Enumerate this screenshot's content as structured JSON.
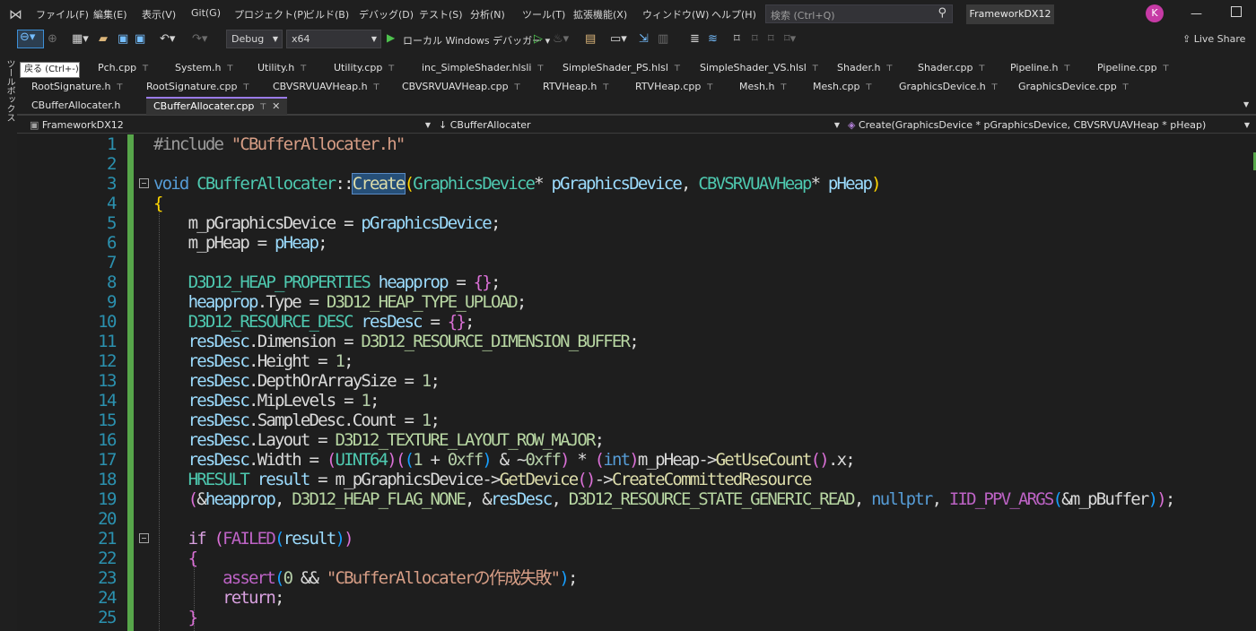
{
  "menubar": {
    "items": [
      "ファイル(F)",
      "編集(E)",
      "表示(V)",
      "Git(G)",
      "プロジェクト(P)",
      "ビルド(B)",
      "デバッグ(D)",
      "テスト(S)",
      "分析(N)",
      "ツール(T)",
      "拡張機能(X)",
      "ウィンドウ(W)",
      "ヘルプ(H)"
    ],
    "search_placeholder": "検索 (Ctrl+Q)",
    "solution_name": "FrameworkDX12",
    "avatar_initial": "K"
  },
  "toolbar": {
    "configuration": "Debug",
    "platform": "x64",
    "run_label": "ローカル Windows デバッガー",
    "live_share": "Live Share"
  },
  "toolbox": {
    "label": "ツールボックス",
    "tooltip": "戻る (Ctrl+-)"
  },
  "tabs": {
    "row1": [
      "Pch.cpp",
      "System.h",
      "Utility.h",
      "Utility.cpp",
      "inc_SimpleShader.hlsli",
      "SimpleShader_PS.hlsl",
      "SimpleShader_VS.hlsl",
      "Shader.h",
      "Shader.cpp",
      "Pipeline.h",
      "Pipeline.cpp"
    ],
    "row2": [
      "RootSignature.h",
      "RootSignature.cpp",
      "CBVSRVUAVHeap.h",
      "CBVSRVUAVHeap.cpp",
      "RTVHeap.h",
      "RTVHeap.cpp",
      "Mesh.h",
      "Mesh.cpp",
      "GraphicsDevice.h",
      "GraphicsDevice.cpp"
    ],
    "row3": [
      "CBufferAllocater.h",
      "CBufferAllocater.cpp"
    ],
    "active": "CBufferAllocater.cpp"
  },
  "navbar": {
    "project": "FrameworkDX12",
    "scope": "CBufferAllocater",
    "member": "Create(GraphicsDevice * pGraphicsDevice, CBVSRVUAVHeap * pHeap)"
  },
  "editor": {
    "line_numbers": [
      "1",
      "2",
      "3",
      "4",
      "5",
      "6",
      "7",
      "8",
      "9",
      "10",
      "11",
      "12",
      "13",
      "14",
      "15",
      "16",
      "17",
      "18",
      "19",
      "20",
      "21",
      "22",
      "23",
      "24",
      "25"
    ]
  },
  "colors": {
    "accent": "#9a7be8",
    "line_number": "#2b91af",
    "keyword": "#569cd6",
    "type": "#4ec9b0",
    "macro": "#bd63c5",
    "change_bar": "#57a64a"
  }
}
